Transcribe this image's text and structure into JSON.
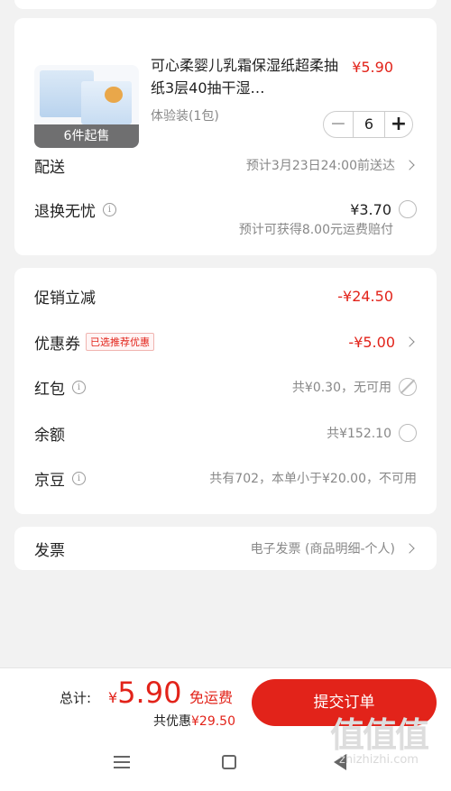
{
  "product": {
    "title": "可心柔婴儿乳霜保湿纸超柔抽纸3层40抽干湿…",
    "price": "¥5.90",
    "spec": "体验装(1包)",
    "min_purchase_badge": "6件起售",
    "quantity": "6",
    "minus_symbol": "−",
    "plus_symbol": "+"
  },
  "delivery": {
    "label": "配送",
    "value": "预计3月23日24:00前送达"
  },
  "return": {
    "label": "退换无忧",
    "price": "¥3.70",
    "note": "预计可获得8.00元运费赔付"
  },
  "discounts": {
    "promo": {
      "label": "促销立减",
      "value": "-¥24.50"
    },
    "coupon": {
      "label": "优惠券",
      "tag": "已选推荐优惠",
      "value": "-¥5.00"
    },
    "red_packet": {
      "label": "红包",
      "value": "共¥0.30，无可用"
    },
    "balance": {
      "label": "余额",
      "value": "共¥152.10"
    },
    "jingdou": {
      "label": "京豆",
      "value": "共有702，本单小于¥20.00，不可用"
    }
  },
  "invoice": {
    "label": "发票",
    "value": "电子发票 (商品明细-个人)"
  },
  "footer": {
    "total_label": "总计:",
    "currency": "¥",
    "total_amount": "5.90",
    "free_shipping": "免运费",
    "discount_label": "共优惠",
    "discount_amount": "¥29.50",
    "submit_label": "提交订单"
  },
  "watermark": {
    "big": "值值值",
    "small": "zhizhizhi.com"
  },
  "colors": {
    "accent": "#e2231a",
    "background": "#f2f2f2",
    "card": "#ffffff",
    "muted": "#888888"
  },
  "icons": [
    "info-icon",
    "chevron-right-icon",
    "radio-icon",
    "disabled-icon",
    "menu-icon",
    "home-icon",
    "back-icon"
  ]
}
